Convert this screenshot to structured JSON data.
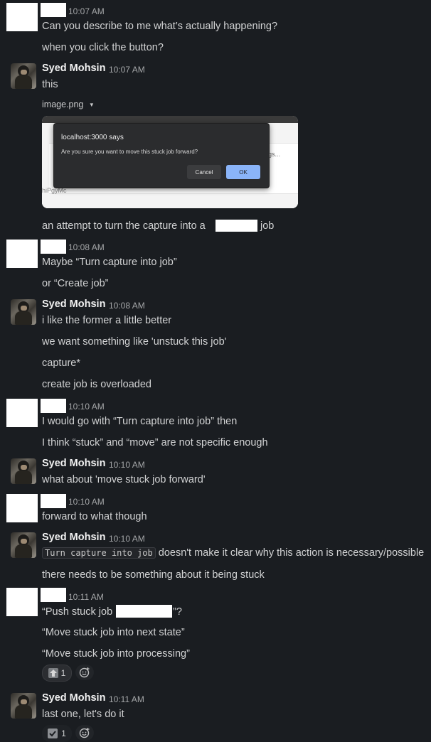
{
  "messages": [
    {
      "time": "10:07 AM",
      "lines": [
        "Can you describe to me what’s actually happening?",
        "when you click the button?"
      ]
    },
    {
      "author": "Syed Mohsin",
      "time": "10:07 AM",
      "lines": [
        "this"
      ],
      "attachment": {
        "filename": "image.png",
        "dialog_title": "localhost:3000 says",
        "dialog_message": "Are you sure you want to move this stuck job forward?",
        "cancel": "Cancel",
        "ok": "OK",
        "bg_left_text": "hiPgyMc",
        "bg_right_text": "gs..."
      },
      "after_lines": [
        "an attempt to turn the capture into a",
        "job"
      ]
    },
    {
      "time": "10:08 AM",
      "lines": [
        "Maybe “Turn capture into job”",
        "or “Create job”"
      ]
    },
    {
      "author": "Syed Mohsin",
      "time": "10:08 AM",
      "lines": [
        "i like the former a little better",
        "we want something like 'unstuck this job'",
        "capture*",
        "create job is overloaded"
      ]
    },
    {
      "time": "10:10 AM",
      "lines": [
        "I would go with “Turn capture into job” then",
        "I think “stuck” and “move” are not specific enough"
      ]
    },
    {
      "author": "Syed Mohsin",
      "time": "10:10 AM",
      "lines": [
        "what about 'move stuck job forward'"
      ]
    },
    {
      "time": "10:10 AM",
      "lines": [
        "forward to what though"
      ]
    },
    {
      "author": "Syed Mohsin",
      "time": "10:10 AM",
      "code": "Turn capture into job",
      "lines": [
        "doesn't make it clear why this action is necessary/possible",
        "there needs to be something about it being stuck"
      ]
    },
    {
      "time": "10:11 AM",
      "lines": [
        "“Push stuck job",
        "”?",
        "“Move stuck job into next state”",
        "“Move stuck job into processing”"
      ],
      "reaction": {
        "count": "1",
        "icon": "arrow-up-icon"
      }
    },
    {
      "author": "Syed Mohsin",
      "time": "10:11 AM",
      "lines": [
        "last one, let's do it"
      ],
      "reaction": {
        "count": "1",
        "icon": "check-box-icon"
      }
    }
  ],
  "colors": {
    "background": "#1a1d21",
    "text": "#d1d2d3",
    "timestamp": "#a4a6a8",
    "redaction": "#ffffff"
  }
}
